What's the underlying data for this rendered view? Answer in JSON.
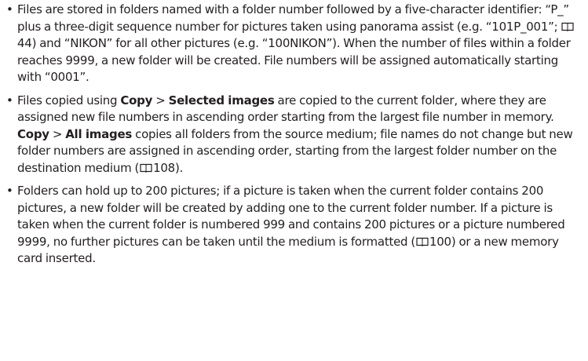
{
  "paragraphs": [
    {
      "p1": "Files are stored in folders named with a folder number followed by a five-character identifier: “P_” plus a three-digit sequence number for pictures taken using panorama assist (e.g. “101P_001”; ",
      "ref1": "44",
      "p2": ") and “NIKON” for all other pictures (e.g. “100NIKON”). When the number of files within a folder reaches 9999, a new folder will be created. File numbers will be assigned automatically starting with “0001”."
    },
    {
      "p1": "Files copied using ",
      "b1": "Copy",
      "p2": " > ",
      "b2": "Selected images",
      "p3": " are copied to the current folder, where they are assigned new file numbers in ascending order starting from the largest file number in memory. ",
      "b3": "Copy",
      "p4": " > ",
      "b4": "All images",
      "p5": " copies all folders from the source medium; file names do not change but new folder numbers are assigned in ascending order, starting from the largest folder number on the destination medium (",
      "ref1": "108",
      "p6": ")."
    },
    {
      "p1": "Folders can hold up to 200 pictures; if a picture is taken when the current folder contains 200 pictures, a new folder will be created by adding one to the current folder number. If a picture is taken when the current folder is numbered 999 and contains 200 pictures or a picture numbered 9999, no further pictures can be taken until the medium is formatted (",
      "ref1": "100",
      "p2": ") or a new memory card inserted."
    }
  ],
  "bullet_glyph": "•",
  "icon_name": "book-reference-icon"
}
